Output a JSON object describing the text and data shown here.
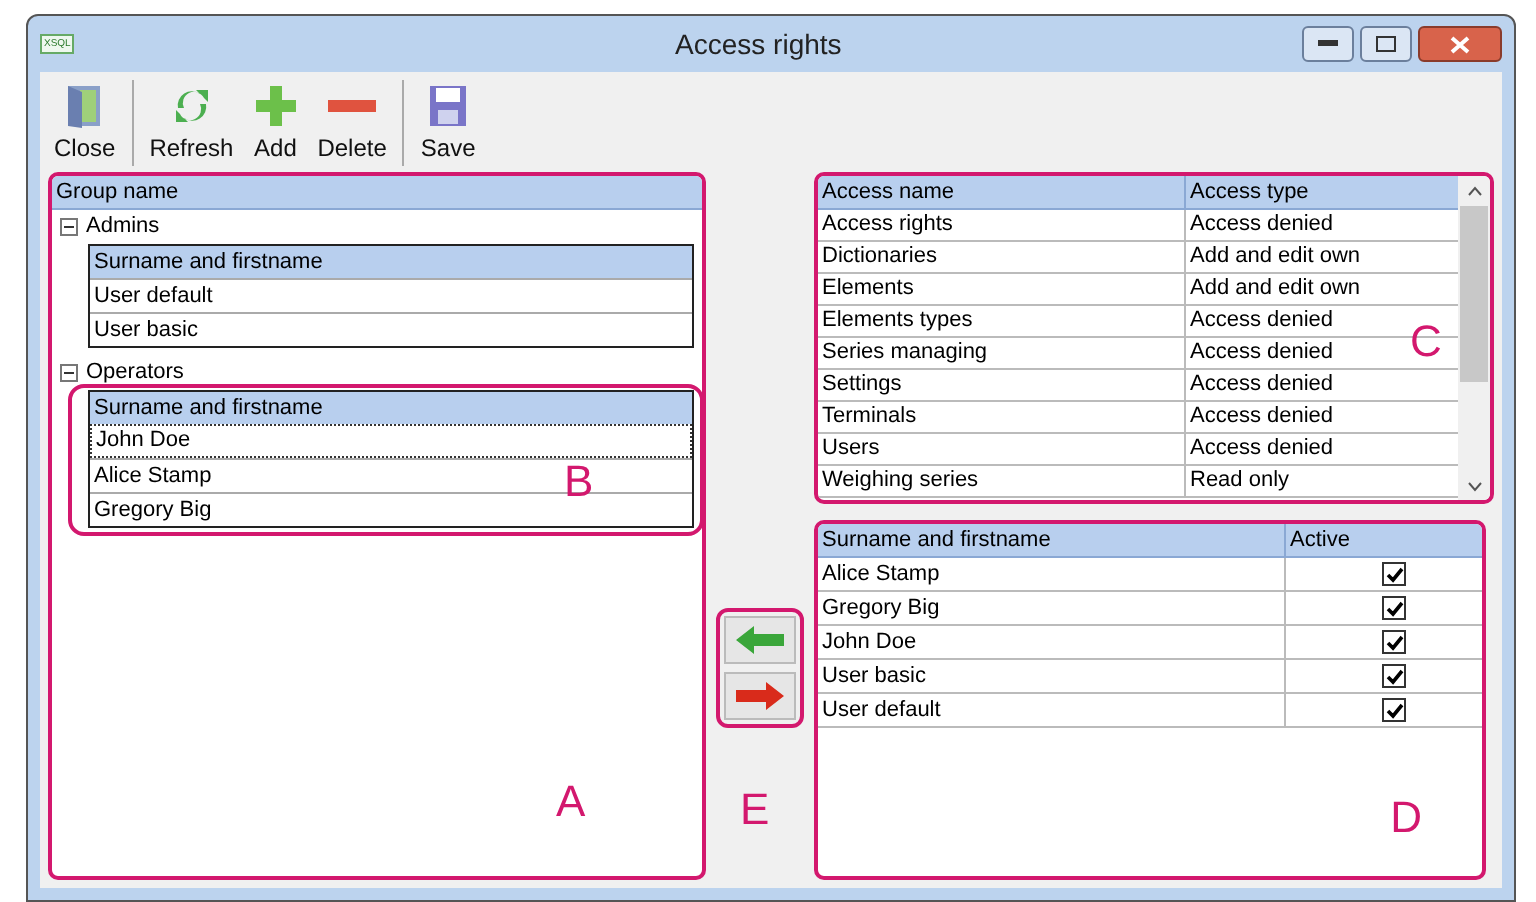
{
  "window": {
    "title": "Access rights",
    "app_icon": "XSQL"
  },
  "toolbar": [
    {
      "kind": "close",
      "label": "Close"
    },
    {
      "kind": "refresh",
      "label": "Refresh"
    },
    {
      "kind": "add",
      "label": "Add"
    },
    {
      "kind": "delete",
      "label": "Delete"
    },
    {
      "kind": "save",
      "label": "Save"
    }
  ],
  "groups": {
    "column": "Group name",
    "items": [
      {
        "name": "Admins",
        "expanded": true,
        "column": "Surname and firstname",
        "rows": [
          {
            "name": "User default",
            "focused": false
          },
          {
            "name": "User basic",
            "focused": false
          }
        ]
      },
      {
        "name": "Operators",
        "expanded": true,
        "column": "Surname and firstname",
        "rows": [
          {
            "name": "John Doe",
            "focused": true
          },
          {
            "name": "Alice Stamp",
            "focused": false
          },
          {
            "name": "Gregory Big",
            "focused": false
          }
        ]
      }
    ]
  },
  "access": {
    "columns": [
      "Access name",
      "Access type"
    ],
    "rows": [
      [
        "Access rights",
        "Access denied"
      ],
      [
        "Dictionaries",
        "Add and edit own"
      ],
      [
        "Elements",
        "Add and edit own"
      ],
      [
        "Elements types",
        "Access denied"
      ],
      [
        "Series managing",
        "Access denied"
      ],
      [
        "Settings",
        "Access denied"
      ],
      [
        "Terminals",
        "Access denied"
      ],
      [
        "Users",
        "Access denied"
      ],
      [
        "Weighing series",
        "Read only"
      ]
    ]
  },
  "members": {
    "columns": [
      "Surname and firstname",
      "Active"
    ],
    "rows": [
      {
        "name": "Alice Stamp",
        "active": true
      },
      {
        "name": "Gregory Big",
        "active": true
      },
      {
        "name": "John Doe",
        "active": true
      },
      {
        "name": "User basic",
        "active": true
      },
      {
        "name": "User default",
        "active": true
      }
    ]
  },
  "annotations": [
    "A",
    "B",
    "C",
    "E",
    "D"
  ]
}
